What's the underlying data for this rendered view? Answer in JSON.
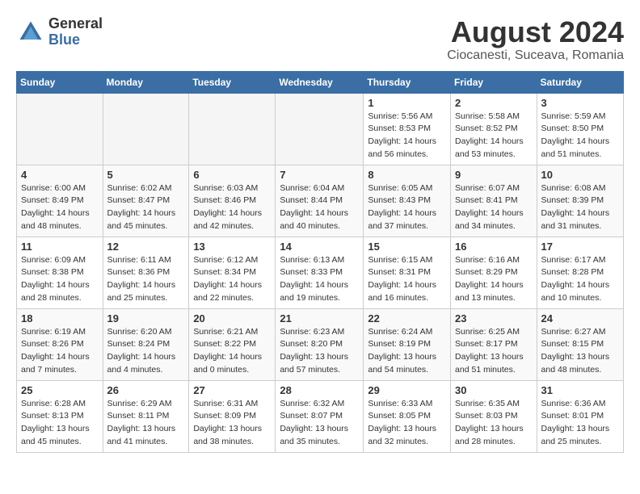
{
  "logo": {
    "general": "General",
    "blue": "Blue"
  },
  "title": "August 2024",
  "location": "Ciocanesti, Suceava, Romania",
  "days_of_week": [
    "Sunday",
    "Monday",
    "Tuesday",
    "Wednesday",
    "Thursday",
    "Friday",
    "Saturday"
  ],
  "weeks": [
    [
      {
        "day": "",
        "empty": true
      },
      {
        "day": "",
        "empty": true
      },
      {
        "day": "",
        "empty": true
      },
      {
        "day": "",
        "empty": true
      },
      {
        "day": "1",
        "sunrise": "5:56 AM",
        "sunset": "8:53 PM",
        "daylight": "14 hours and 56 minutes."
      },
      {
        "day": "2",
        "sunrise": "5:58 AM",
        "sunset": "8:52 PM",
        "daylight": "14 hours and 53 minutes."
      },
      {
        "day": "3",
        "sunrise": "5:59 AM",
        "sunset": "8:50 PM",
        "daylight": "14 hours and 51 minutes."
      }
    ],
    [
      {
        "day": "4",
        "sunrise": "6:00 AM",
        "sunset": "8:49 PM",
        "daylight": "14 hours and 48 minutes."
      },
      {
        "day": "5",
        "sunrise": "6:02 AM",
        "sunset": "8:47 PM",
        "daylight": "14 hours and 45 minutes."
      },
      {
        "day": "6",
        "sunrise": "6:03 AM",
        "sunset": "8:46 PM",
        "daylight": "14 hours and 42 minutes."
      },
      {
        "day": "7",
        "sunrise": "6:04 AM",
        "sunset": "8:44 PM",
        "daylight": "14 hours and 40 minutes."
      },
      {
        "day": "8",
        "sunrise": "6:05 AM",
        "sunset": "8:43 PM",
        "daylight": "14 hours and 37 minutes."
      },
      {
        "day": "9",
        "sunrise": "6:07 AM",
        "sunset": "8:41 PM",
        "daylight": "14 hours and 34 minutes."
      },
      {
        "day": "10",
        "sunrise": "6:08 AM",
        "sunset": "8:39 PM",
        "daylight": "14 hours and 31 minutes."
      }
    ],
    [
      {
        "day": "11",
        "sunrise": "6:09 AM",
        "sunset": "8:38 PM",
        "daylight": "14 hours and 28 minutes."
      },
      {
        "day": "12",
        "sunrise": "6:11 AM",
        "sunset": "8:36 PM",
        "daylight": "14 hours and 25 minutes."
      },
      {
        "day": "13",
        "sunrise": "6:12 AM",
        "sunset": "8:34 PM",
        "daylight": "14 hours and 22 minutes."
      },
      {
        "day": "14",
        "sunrise": "6:13 AM",
        "sunset": "8:33 PM",
        "daylight": "14 hours and 19 minutes."
      },
      {
        "day": "15",
        "sunrise": "6:15 AM",
        "sunset": "8:31 PM",
        "daylight": "14 hours and 16 minutes."
      },
      {
        "day": "16",
        "sunrise": "6:16 AM",
        "sunset": "8:29 PM",
        "daylight": "14 hours and 13 minutes."
      },
      {
        "day": "17",
        "sunrise": "6:17 AM",
        "sunset": "8:28 PM",
        "daylight": "14 hours and 10 minutes."
      }
    ],
    [
      {
        "day": "18",
        "sunrise": "6:19 AM",
        "sunset": "8:26 PM",
        "daylight": "14 hours and 7 minutes."
      },
      {
        "day": "19",
        "sunrise": "6:20 AM",
        "sunset": "8:24 PM",
        "daylight": "14 hours and 4 minutes."
      },
      {
        "day": "20",
        "sunrise": "6:21 AM",
        "sunset": "8:22 PM",
        "daylight": "14 hours and 0 minutes."
      },
      {
        "day": "21",
        "sunrise": "6:23 AM",
        "sunset": "8:20 PM",
        "daylight": "13 hours and 57 minutes."
      },
      {
        "day": "22",
        "sunrise": "6:24 AM",
        "sunset": "8:19 PM",
        "daylight": "13 hours and 54 minutes."
      },
      {
        "day": "23",
        "sunrise": "6:25 AM",
        "sunset": "8:17 PM",
        "daylight": "13 hours and 51 minutes."
      },
      {
        "day": "24",
        "sunrise": "6:27 AM",
        "sunset": "8:15 PM",
        "daylight": "13 hours and 48 minutes."
      }
    ],
    [
      {
        "day": "25",
        "sunrise": "6:28 AM",
        "sunset": "8:13 PM",
        "daylight": "13 hours and 45 minutes."
      },
      {
        "day": "26",
        "sunrise": "6:29 AM",
        "sunset": "8:11 PM",
        "daylight": "13 hours and 41 minutes."
      },
      {
        "day": "27",
        "sunrise": "6:31 AM",
        "sunset": "8:09 PM",
        "daylight": "13 hours and 38 minutes."
      },
      {
        "day": "28",
        "sunrise": "6:32 AM",
        "sunset": "8:07 PM",
        "daylight": "13 hours and 35 minutes."
      },
      {
        "day": "29",
        "sunrise": "6:33 AM",
        "sunset": "8:05 PM",
        "daylight": "13 hours and 32 minutes."
      },
      {
        "day": "30",
        "sunrise": "6:35 AM",
        "sunset": "8:03 PM",
        "daylight": "13 hours and 28 minutes."
      },
      {
        "day": "31",
        "sunrise": "6:36 AM",
        "sunset": "8:01 PM",
        "daylight": "13 hours and 25 minutes."
      }
    ]
  ]
}
